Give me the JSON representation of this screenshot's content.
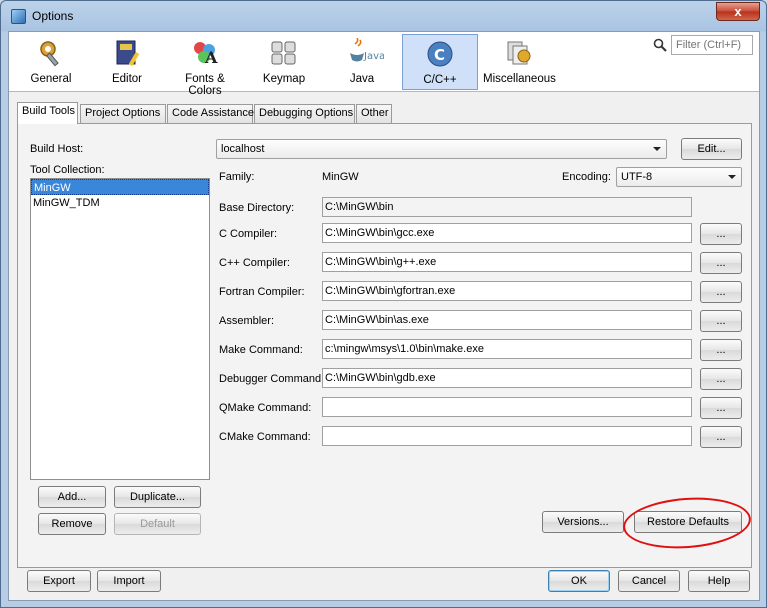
{
  "window": {
    "title": "Options",
    "close_glyph": "x"
  },
  "categories": [
    {
      "label": "General",
      "icon": "gear-wrench-icon"
    },
    {
      "label": "Editor",
      "icon": "editor-book-icon"
    },
    {
      "label": "Fonts & Colors",
      "icon": "fonts-colors-icon"
    },
    {
      "label": "Keymap",
      "icon": "keyboard-icon"
    },
    {
      "label": "Java",
      "icon": "java-icon"
    },
    {
      "label": "C/C++",
      "icon": "cpp-icon"
    },
    {
      "label": "Miscellaneous",
      "icon": "misc-icon"
    }
  ],
  "filter": {
    "placeholder": "Filter (Ctrl+F)"
  },
  "tabs": [
    "Build Tools",
    "Project Options",
    "Code Assistance",
    "Debugging Options",
    "Other"
  ],
  "build_host": {
    "label": "Build Host:",
    "value": "localhost",
    "edit_button": "Edit..."
  },
  "tool_collection": {
    "label": "Tool Collection:",
    "items": [
      "MinGW",
      "MinGW_TDM"
    ]
  },
  "family": {
    "label": "Family:",
    "value": "MinGW"
  },
  "encoding": {
    "label": "Encoding:",
    "value": "UTF-8"
  },
  "fields": [
    {
      "label": "Base Directory:",
      "value": "C:\\MinGW\\bin"
    },
    {
      "label": "C Compiler:",
      "value": "C:\\MinGW\\bin\\gcc.exe"
    },
    {
      "label": "C++ Compiler:",
      "value": "C:\\MinGW\\bin\\g++.exe"
    },
    {
      "label": "Fortran Compiler:",
      "value": "C:\\MinGW\\bin\\gfortran.exe"
    },
    {
      "label": "Assembler:",
      "value": "C:\\MinGW\\bin\\as.exe"
    },
    {
      "label": "Make Command:",
      "value": "c:\\mingw\\msys\\1.0\\bin\\make.exe"
    },
    {
      "label": "Debugger Command:",
      "value": "C:\\MinGW\\bin\\gdb.exe"
    },
    {
      "label": "QMake Command:",
      "value": ""
    },
    {
      "label": "CMake Command:",
      "value": ""
    }
  ],
  "browse_label": "...",
  "list_buttons": {
    "add": "Add...",
    "duplicate": "Duplicate...",
    "remove": "Remove",
    "default": "Default"
  },
  "versions_button": "Versions...",
  "restore_defaults_button": "Restore Defaults",
  "footer": {
    "export": "Export",
    "import": "Import",
    "ok": "OK",
    "cancel": "Cancel",
    "help": "Help"
  },
  "colors": {
    "selection": "#3a86d8",
    "annotation": "#e01010",
    "selected_category": "#cfe0f8"
  }
}
